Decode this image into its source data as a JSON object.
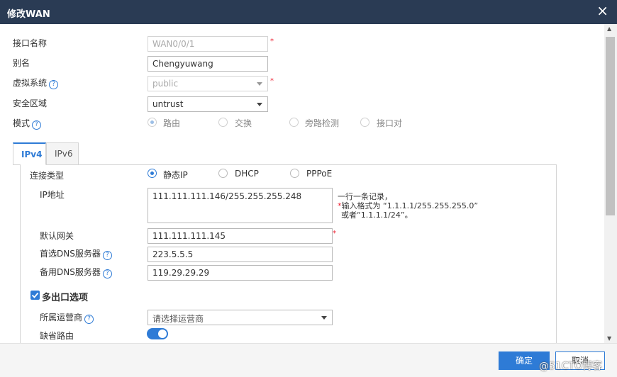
{
  "dialog": {
    "title": "修改WAN",
    "close_icon": "×"
  },
  "form": {
    "interface_name": {
      "label": "接口名称",
      "value": "WAN0/0/1",
      "required": "*"
    },
    "alias": {
      "label": "别名",
      "value": "Chengyuwang"
    },
    "virtual_system": {
      "label": "虚拟系统",
      "value": "public",
      "required": "*"
    },
    "security_zone": {
      "label": "安全区域",
      "value": "untrust"
    },
    "mode": {
      "label": "模式",
      "options": [
        {
          "label": "路由",
          "selected": true
        },
        {
          "label": "交换",
          "selected": false
        },
        {
          "label": "旁路检测",
          "selected": false
        },
        {
          "label": "接口对",
          "selected": false
        }
      ]
    }
  },
  "tabs": [
    {
      "label": "IPv4",
      "active": true
    },
    {
      "label": "IPv6",
      "active": false
    }
  ],
  "ipv4": {
    "connection_type": {
      "label": "连接类型",
      "options": [
        {
          "label": "静态IP",
          "selected": true
        },
        {
          "label": "DHCP",
          "selected": false
        },
        {
          "label": "PPPoE",
          "selected": false
        }
      ]
    },
    "ip_address": {
      "label": "IP地址",
      "value": "111.111.111.146/255.255.255.248"
    },
    "hint": {
      "line1": "一行一条记录，",
      "star": "*",
      "line2": "输入格式为 “1.1.1.1/255.255.255.0”",
      "line3": "或者“1.1.1.1/24”。"
    },
    "default_gateway": {
      "label": "默认网关",
      "value": "111.111.111.145",
      "required": "*"
    },
    "primary_dns": {
      "label": "首选DNS服务器",
      "value": "223.5.5.5"
    },
    "secondary_dns": {
      "label": "备用DNS服务器",
      "value": "119.29.29.29"
    },
    "multi_egress": {
      "label": "多出口选项",
      "checked": true
    },
    "isp": {
      "label": "所属运营商",
      "placeholder": "请选择运营商"
    },
    "default_route": {
      "label": "缺省路由",
      "enabled": true
    }
  },
  "footer": {
    "ok_label": "确定",
    "cancel_label": "取消"
  },
  "watermark": "@51CTO博客",
  "colors": {
    "titlebar": "#2a3b54",
    "accent": "#2e7bd6",
    "required": "#e23"
  },
  "help_icon": "?"
}
